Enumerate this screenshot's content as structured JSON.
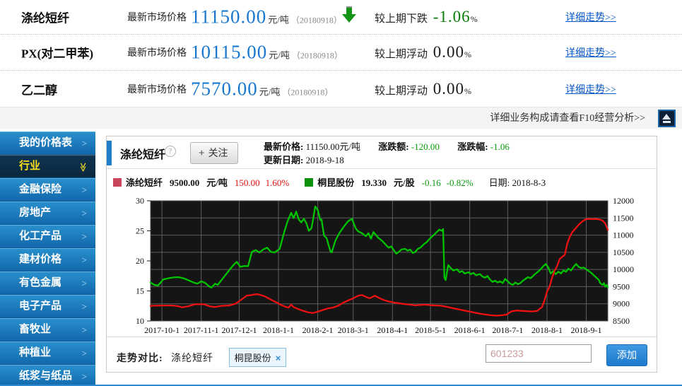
{
  "quotes": {
    "market_label": "最新市场价格",
    "rows": [
      {
        "name": "涤纶短纤",
        "price": "11150.00",
        "unit": "元/吨",
        "date": "（20180918）",
        "arrow": "down",
        "change_label": "较上期下跌",
        "change_value": "-1.06",
        "change_unit": "%",
        "change_tone": "neg",
        "link": "详细走势>>"
      },
      {
        "name": "PX(对二甲苯)",
        "price": "10115.00",
        "unit": "元/吨",
        "date": "（20180918）",
        "arrow": "none",
        "change_label": "较上期浮动",
        "change_value": "0.00",
        "change_unit": "%",
        "change_tone": "flat",
        "link": "详细走势>>"
      },
      {
        "name": "乙二醇",
        "price": "7570.00",
        "unit": "元/吨",
        "date": "（20180918）",
        "arrow": "none",
        "change_label": "较上期浮动",
        "change_value": "0.00",
        "change_unit": "%",
        "change_tone": "flat",
        "link": "详细走势>>"
      }
    ]
  },
  "f10": {
    "notice": "详细业务构成请查看F10经营分析>>"
  },
  "sidebar": {
    "items": [
      {
        "label": "我的价格表",
        "active": false
      },
      {
        "label": "行业",
        "active": true
      },
      {
        "label": "金融保险",
        "active": false
      },
      {
        "label": "房地产",
        "active": false
      },
      {
        "label": "化工产品",
        "active": false
      },
      {
        "label": "建材价格",
        "active": false
      },
      {
        "label": "有色金属",
        "active": false
      },
      {
        "label": "电子产品",
        "active": false
      },
      {
        "label": "畜牧业",
        "active": false
      },
      {
        "label": "种植业",
        "active": false
      },
      {
        "label": "纸浆与纸品",
        "active": false
      }
    ]
  },
  "panel": {
    "title": "涤纶短纤",
    "help": "?",
    "follow_plus": "+",
    "follow_label": "关注",
    "info": {
      "latest_label": "最新价格:",
      "latest_value": "11150.00元/吨",
      "amt_label": "涨跌额:",
      "amt_value": "-120.00",
      "pct_label": "涨跌幅:",
      "pct_value": "-1.06",
      "update_label": "更新日期:",
      "update_value": "2018-9-18"
    }
  },
  "legend": {
    "s1": {
      "name": "涤纶短纤",
      "price": "9500.00",
      "unit": "元/吨",
      "change": "150.00",
      "pct": "1.60%",
      "color": "#c8455c"
    },
    "s2": {
      "name": "桐昆股份",
      "price": "19.330",
      "unit": "元/股",
      "change": "-0.16",
      "pct": "-0.82%",
      "color": "#0a930a"
    },
    "date_label": "日期:",
    "date": "2018-8-3"
  },
  "compare": {
    "label": "走势对比:",
    "base": "涤纶短纤",
    "tag": "桐昆股份",
    "close": "×",
    "input_placeholder": "601233",
    "add_label": "添加"
  },
  "chart_data": {
    "type": "line",
    "background": "#151515",
    "grid_color": "#5e5e5e",
    "x_range_days": 361,
    "x_ticks": [
      {
        "day": 9,
        "label": "2017-10-1"
      },
      {
        "day": 40,
        "label": "2017-11-1"
      },
      {
        "day": 70,
        "label": "2017-12-1"
      },
      {
        "day": 101,
        "label": "2018-1-1"
      },
      {
        "day": 132,
        "label": "2018-2-1"
      },
      {
        "day": 160,
        "label": "2018-3-1"
      },
      {
        "day": 191,
        "label": "2018-4-1"
      },
      {
        "day": 221,
        "label": "2018-5-1"
      },
      {
        "day": 252,
        "label": "2018-6-1"
      },
      {
        "day": 282,
        "label": "2018-7-1"
      },
      {
        "day": 313,
        "label": "2018-8-1"
      },
      {
        "day": 344,
        "label": "2018-9-1"
      }
    ],
    "left_axis": {
      "min": 10,
      "max": 30,
      "ticks": [
        10,
        15,
        20,
        25,
        30
      ],
      "label_for": "桐昆股份(元/股)"
    },
    "right_axis": {
      "min": 8500,
      "max": 12000,
      "ticks": [
        8500,
        9000,
        9500,
        10000,
        10500,
        11000,
        11500,
        12000
      ],
      "label_for": "涤纶短纤(元/吨)"
    },
    "series": [
      {
        "name": "桐昆股份",
        "axis": "left",
        "color": "#00c400",
        "points": [
          [
            0,
            16.4
          ],
          [
            3,
            16.0
          ],
          [
            6,
            15.9
          ],
          [
            10,
            16.9
          ],
          [
            14,
            17.1
          ],
          [
            18,
            17.25
          ],
          [
            22,
            17.3
          ],
          [
            26,
            17.1
          ],
          [
            30,
            16.75
          ],
          [
            34,
            16.4
          ],
          [
            37,
            16.2
          ],
          [
            40,
            16.6
          ],
          [
            43,
            16.35
          ],
          [
            46,
            15.8
          ],
          [
            48,
            15.55
          ],
          [
            51,
            16.2
          ],
          [
            53,
            16.0
          ],
          [
            56,
            16.8
          ],
          [
            59,
            17.6
          ],
          [
            62,
            18.4
          ],
          [
            65,
            19.2
          ],
          [
            68,
            19.85
          ],
          [
            71,
            19.0
          ],
          [
            74,
            19.15
          ],
          [
            77,
            19.1
          ],
          [
            80,
            21.5
          ],
          [
            83,
            21.8
          ],
          [
            86,
            21.4
          ],
          [
            89,
            21.9
          ],
          [
            92,
            22.2
          ],
          [
            95,
            21.5
          ],
          [
            98,
            21.4
          ],
          [
            102,
            22.0
          ],
          [
            105,
            24.4
          ],
          [
            108,
            26.5
          ],
          [
            111,
            28.0
          ],
          [
            113,
            27.1
          ],
          [
            115,
            28.2
          ],
          [
            117,
            26.9
          ],
          [
            119,
            26.4
          ],
          [
            121,
            27.0
          ],
          [
            123,
            26.3
          ],
          [
            125,
            25.0
          ],
          [
            127,
            25.4
          ],
          [
            128,
            26.5
          ],
          [
            130,
            29.05
          ],
          [
            132,
            28.5
          ],
          [
            134,
            26.8
          ],
          [
            135,
            26.9
          ],
          [
            137,
            24.2
          ],
          [
            139,
            23.8
          ],
          [
            142,
            21.6
          ],
          [
            143,
            21.4
          ],
          [
            146,
            23.4
          ],
          [
            149,
            24.6
          ],
          [
            153,
            25.8
          ],
          [
            156,
            26.6
          ],
          [
            159,
            27.0
          ],
          [
            162,
            25.4
          ],
          [
            164,
            24.9
          ],
          [
            167,
            24.6
          ],
          [
            170,
            24.1
          ],
          [
            172,
            24.6
          ],
          [
            174,
            23.7
          ],
          [
            176,
            24.8
          ],
          [
            178,
            24.3
          ],
          [
            180,
            23.8
          ],
          [
            183,
            23.3
          ],
          [
            186,
            22.6
          ],
          [
            188,
            22.2
          ],
          [
            190,
            22.4
          ],
          [
            192,
            21.8
          ],
          [
            194,
            21.2
          ],
          [
            196,
            21.5
          ],
          [
            198,
            21.9
          ],
          [
            201,
            22.0
          ],
          [
            203,
            21.7
          ],
          [
            205,
            21.9
          ],
          [
            207,
            21.3
          ],
          [
            209,
            21.5
          ],
          [
            211,
            22.0
          ],
          [
            213,
            22.2
          ],
          [
            216,
            22.8
          ],
          [
            218,
            23.1
          ],
          [
            220,
            23.6
          ],
          [
            223,
            24.2
          ],
          [
            226,
            24.8
          ],
          [
            228,
            25.2
          ],
          [
            230,
            25.0
          ],
          [
            231,
            25.3
          ],
          [
            232,
            17.2
          ],
          [
            233,
            16.8
          ],
          [
            235,
            19.3
          ],
          [
            237,
            18.8
          ],
          [
            239,
            18.4
          ],
          [
            242,
            18.6
          ],
          [
            244,
            18.1
          ],
          [
            246,
            18.3
          ],
          [
            248,
            17.9
          ],
          [
            251,
            18.1
          ],
          [
            253,
            17.8
          ],
          [
            255,
            18.0
          ],
          [
            257,
            17.6
          ],
          [
            260,
            17.8
          ],
          [
            262,
            17.4
          ],
          [
            264,
            17.2
          ],
          [
            266,
            17.5
          ],
          [
            268,
            16.9
          ],
          [
            270,
            16.5
          ],
          [
            272,
            16.7
          ],
          [
            274,
            16.4
          ],
          [
            276,
            16.6
          ],
          [
            278,
            16.3
          ],
          [
            280,
            17.0
          ],
          [
            282,
            16.6
          ],
          [
            284,
            16.2
          ],
          [
            286,
            16.0
          ],
          [
            288,
            16.4
          ],
          [
            290,
            16.1
          ],
          [
            292,
            16.3
          ],
          [
            294,
            16.7
          ],
          [
            296,
            17.0
          ],
          [
            298,
            17.3
          ],
          [
            300,
            17.1
          ],
          [
            302,
            17.5
          ],
          [
            304,
            17.9
          ],
          [
            306,
            18.2
          ],
          [
            308,
            18.6
          ],
          [
            310,
            19.1
          ],
          [
            312,
            19.5
          ],
          [
            314,
            18.9
          ],
          [
            316,
            17.9
          ],
          [
            318,
            18.3
          ],
          [
            320,
            17.8
          ],
          [
            322,
            18.2
          ],
          [
            324,
            17.9
          ],
          [
            326,
            18.4
          ],
          [
            328,
            18.2
          ],
          [
            330,
            18.7
          ],
          [
            332,
            18.4
          ],
          [
            334,
            19.0
          ],
          [
            336,
            19.5
          ],
          [
            338,
            19.0
          ],
          [
            340,
            18.8
          ],
          [
            342,
            18.9
          ],
          [
            344,
            18.6
          ],
          [
            346,
            18.3
          ],
          [
            348,
            18.0
          ],
          [
            350,
            17.6
          ],
          [
            352,
            17.2
          ],
          [
            354,
            16.8
          ],
          [
            355,
            16.3
          ],
          [
            357,
            16.0
          ],
          [
            358,
            16.3
          ],
          [
            359,
            15.7
          ],
          [
            360,
            16.0
          ],
          [
            361,
            15.6
          ]
        ]
      },
      {
        "name": "涤纶短纤",
        "axis": "right",
        "color": "#ee1111",
        "points": [
          [
            0,
            8940
          ],
          [
            9,
            8950
          ],
          [
            17,
            8950
          ],
          [
            22,
            8930
          ],
          [
            25,
            8895
          ],
          [
            30,
            8930
          ],
          [
            35,
            8985
          ],
          [
            42,
            8985
          ],
          [
            47,
            8925
          ],
          [
            51,
            8905
          ],
          [
            56,
            8940
          ],
          [
            62,
            8950
          ],
          [
            67,
            9000
          ],
          [
            72,
            9130
          ],
          [
            76,
            9240
          ],
          [
            80,
            9255
          ],
          [
            84,
            9283
          ],
          [
            87,
            9255
          ],
          [
            90,
            9220
          ],
          [
            93,
            9160
          ],
          [
            97,
            9085
          ],
          [
            100,
            9030
          ],
          [
            104,
            8950
          ],
          [
            107,
            8905
          ],
          [
            109,
            8890
          ],
          [
            111,
            8975
          ],
          [
            113,
            8905
          ],
          [
            116,
            8855
          ],
          [
            120,
            8800
          ],
          [
            124,
            8755
          ],
          [
            128,
            8730
          ],
          [
            132,
            8770
          ],
          [
            136,
            8820
          ],
          [
            140,
            8865
          ],
          [
            144,
            8890
          ],
          [
            148,
            8940
          ],
          [
            152,
            9030
          ],
          [
            156,
            9100
          ],
          [
            160,
            9160
          ],
          [
            164,
            9235
          ],
          [
            167,
            9255
          ],
          [
            170,
            9200
          ],
          [
            173,
            9160
          ],
          [
            177,
            9235
          ],
          [
            181,
            9160
          ],
          [
            185,
            9100
          ],
          [
            189,
            9060
          ],
          [
            193,
            9030
          ],
          [
            197,
            9010
          ],
          [
            201,
            8990
          ],
          [
            205,
            8975
          ],
          [
            209,
            8955
          ],
          [
            213,
            8965
          ],
          [
            217,
            8975
          ],
          [
            221,
            8960
          ],
          [
            225,
            8950
          ],
          [
            229,
            8945
          ],
          [
            233,
            8920
          ],
          [
            237,
            8885
          ],
          [
            241,
            8855
          ],
          [
            245,
            8825
          ],
          [
            249,
            8795
          ],
          [
            253,
            8765
          ],
          [
            257,
            8735
          ],
          [
            261,
            8705
          ],
          [
            265,
            8685
          ],
          [
            269,
            8665
          ],
          [
            273,
            8655
          ],
          [
            277,
            8665
          ],
          [
            281,
            8685
          ],
          [
            285,
            8780
          ],
          [
            289,
            8805
          ],
          [
            293,
            8795
          ],
          [
            297,
            8785
          ],
          [
            301,
            8775
          ],
          [
            305,
            8790
          ],
          [
            309,
            8900
          ],
          [
            311,
            9100
          ],
          [
            313,
            9350
          ],
          [
            315,
            9500
          ],
          [
            317,
            9750
          ],
          [
            319,
            9960
          ],
          [
            321,
            10100
          ],
          [
            323,
            10300
          ],
          [
            325,
            10370
          ],
          [
            327,
            10420
          ],
          [
            329,
            10750
          ],
          [
            331,
            10950
          ],
          [
            333,
            11090
          ],
          [
            335,
            11170
          ],
          [
            337,
            11260
          ],
          [
            339,
            11340
          ],
          [
            341,
            11400
          ],
          [
            343,
            11450
          ],
          [
            345,
            11470
          ],
          [
            347,
            11470
          ],
          [
            349,
            11465
          ],
          [
            351,
            11470
          ],
          [
            353,
            11465
          ],
          [
            355,
            11450
          ],
          [
            357,
            11420
          ],
          [
            359,
            11340
          ],
          [
            360,
            11250
          ],
          [
            361,
            11150
          ]
        ]
      }
    ]
  }
}
